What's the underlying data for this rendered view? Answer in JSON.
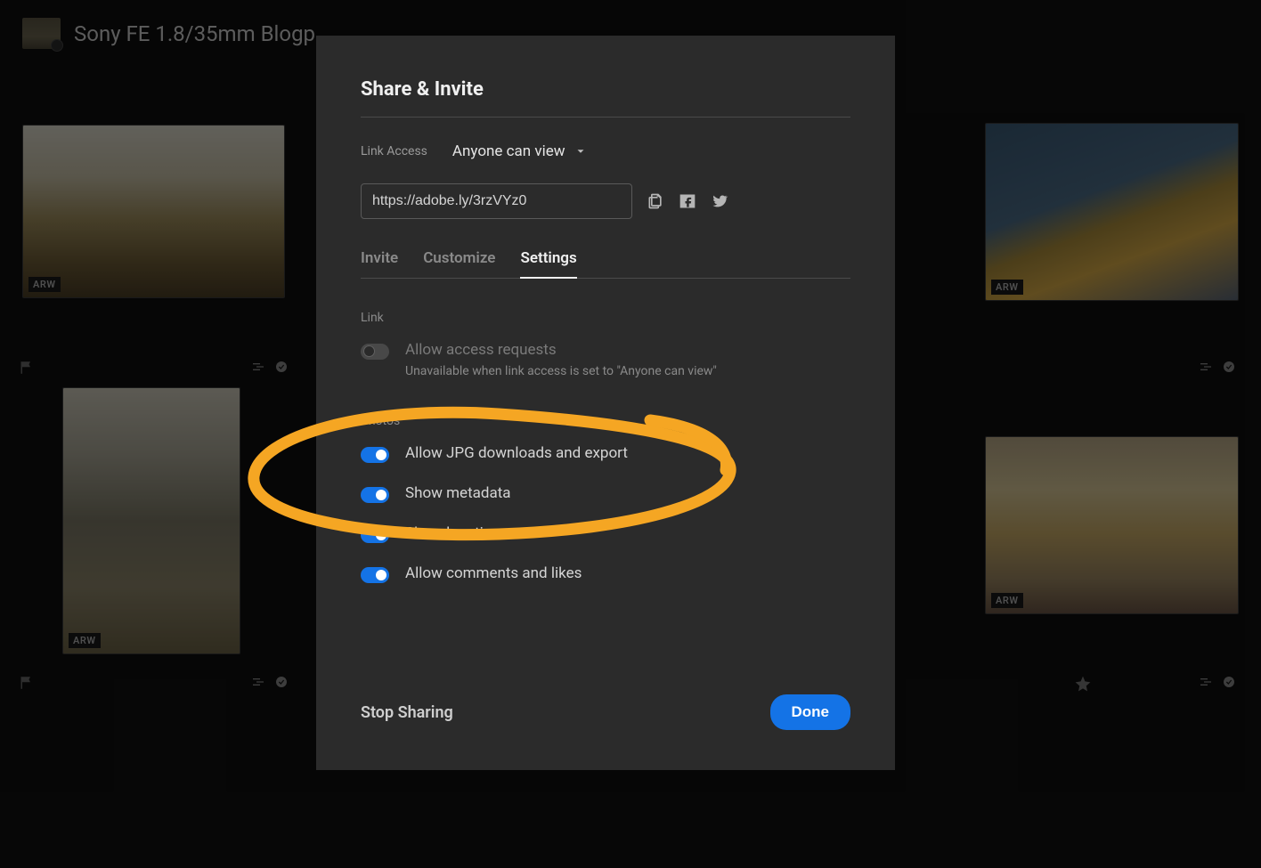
{
  "page": {
    "title": "Sony FE 1.8/35mm Blogp..."
  },
  "thumbs": {
    "t1_badge": "ARW",
    "t2_badge": "ARW",
    "t3_badge": "ARW",
    "t4_badge": "ARW"
  },
  "modal": {
    "title": "Share & Invite",
    "link_access_label": "Link Access",
    "link_access_value": "Anyone can view",
    "url": "https://adobe.ly/3rzVYz0",
    "tabs": {
      "invite": "Invite",
      "customize": "Customize",
      "settings": "Settings"
    },
    "sections": {
      "link_label": "Link",
      "photos_label": "Photos"
    },
    "settings": {
      "access_requests": {
        "title": "Allow access requests",
        "subtitle": "Unavailable when link access is set to \"Anyone can view\""
      },
      "jpg": "Allow JPG downloads and export",
      "metadata": "Show metadata",
      "location": "Show location",
      "comments": "Allow comments and likes"
    },
    "footer": {
      "stop": "Stop Sharing",
      "done": "Done"
    }
  }
}
